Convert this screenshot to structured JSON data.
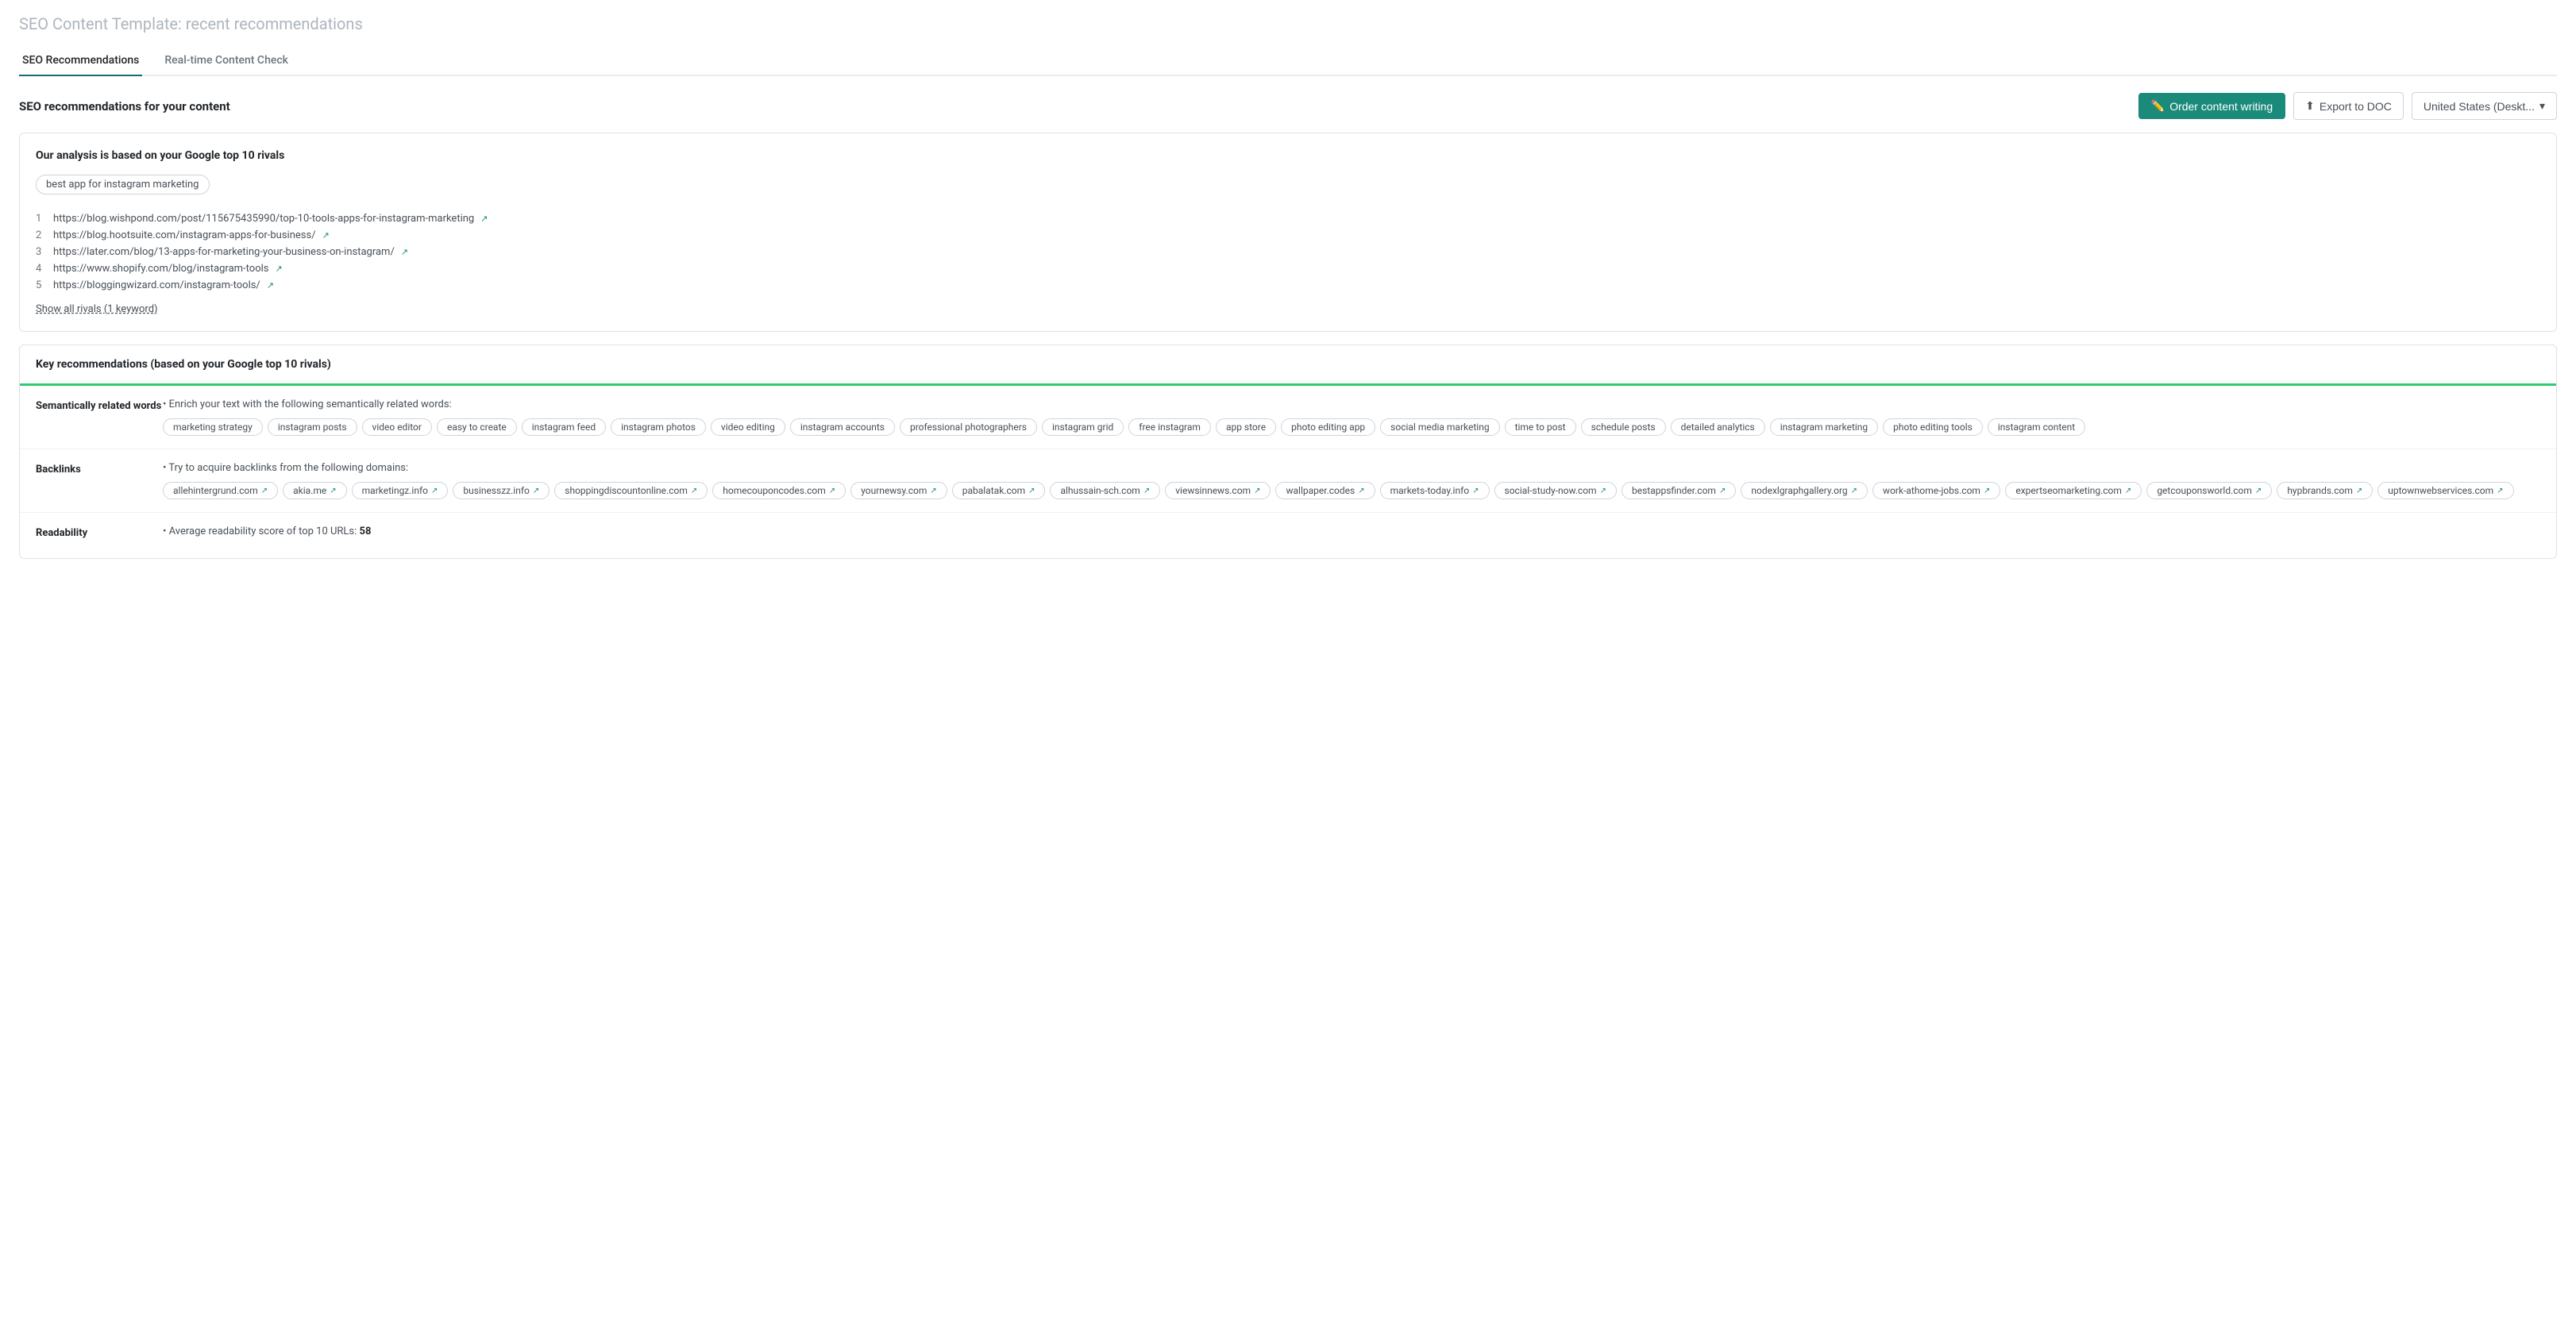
{
  "page": {
    "title_bold": "SEO Content Template:",
    "title_light": "recent recommendations"
  },
  "tabs": [
    {
      "id": "seo-recommendations",
      "label": "SEO Recommendations",
      "active": true
    },
    {
      "id": "realtime-check",
      "label": "Real-time Content Check",
      "active": false
    }
  ],
  "toolbar": {
    "section_title": "SEO recommendations for your content",
    "btn_order_label": "Order content writing",
    "btn_export_label": "Export to DOC",
    "btn_location_label": "United States (Deskt..."
  },
  "rivals_card": {
    "title": "Our analysis is based on your Google top 10 rivals",
    "keyword": "best app for instagram marketing",
    "rivals": [
      {
        "num": "1",
        "url": "https://blog.wishpond.com/post/115675435990/top-10-tools-apps-for-instagram-marketing"
      },
      {
        "num": "2",
        "url": "https://blog.hootsuite.com/instagram-apps-for-business/"
      },
      {
        "num": "3",
        "url": "https://later.com/blog/13-apps-for-marketing-your-business-on-instagram/"
      },
      {
        "num": "4",
        "url": "https://www.shopify.com/blog/instagram-tools"
      },
      {
        "num": "5",
        "url": "https://bloggingwizard.com/instagram-tools/"
      }
    ],
    "show_all_label": "Show all rivals (1 keyword)"
  },
  "key_recommendations": {
    "header": "Key recommendations (based on your Google top 10 rivals)",
    "sections": [
      {
        "id": "semantically-related",
        "label": "Semantically related words",
        "intro": "• Enrich your text with the following semantically related words:",
        "items": [
          "marketing strategy",
          "instagram posts",
          "video editor",
          "easy to create",
          "instagram feed",
          "instagram photos",
          "video editing",
          "instagram accounts",
          "professional photographers",
          "instagram grid",
          "free instagram",
          "app store",
          "photo editing app",
          "social media marketing",
          "time to post",
          "schedule posts",
          "detailed analytics",
          "instagram marketing",
          "photo editing tools",
          "instagram content"
        ],
        "has_ext": false
      },
      {
        "id": "backlinks",
        "label": "Backlinks",
        "intro": "• Try to acquire backlinks from the following domains:",
        "items": [
          "allehintergrund.com",
          "akia.me",
          "marketingz.info",
          "businesszz.info",
          "shoppingdiscountonline.com",
          "homecouponcodes.com",
          "yournewsy.com",
          "pabalatak.com",
          "alhussain-sch.com",
          "viewsinnews.com",
          "wallpaper.codes",
          "markets-today.info",
          "social-study-now.com",
          "bestappsfinder.com",
          "nodexlgraphgallery.org",
          "work-athome-jobs.com",
          "expertseomarketing.com",
          "getcouponsworld.com",
          "hypbrands.com",
          "uptownwebservices.com"
        ],
        "has_ext": true
      },
      {
        "id": "readability",
        "label": "Readability",
        "intro": "• Average readability score of top 10 URLs:",
        "score": "58",
        "items": []
      }
    ]
  }
}
